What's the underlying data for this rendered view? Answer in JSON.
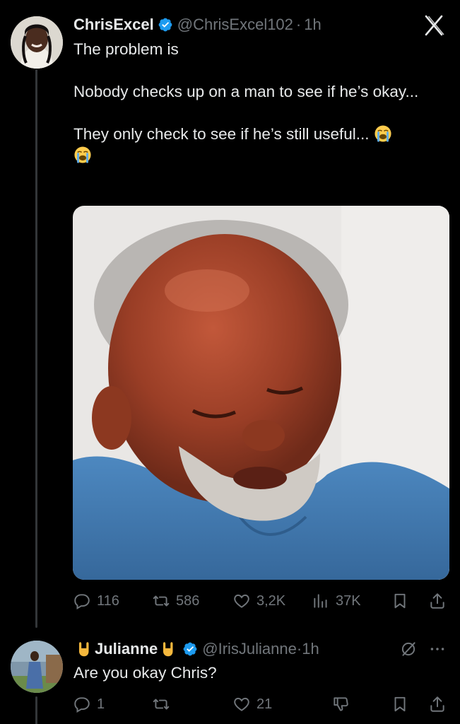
{
  "tweet": {
    "author_name": "ChrisExcel",
    "handle": "@ChrisExcel102",
    "separator": "·",
    "time": "1h",
    "paragraphs": [
      "The problem is",
      "Nobody checks up on a man to see if he’s okay...",
      "They only check to see if he’s still useful..."
    ],
    "emojis": [
      "loudly-crying-face",
      "loudly-crying-face"
    ],
    "media_alt": "",
    "stats": {
      "replies": "116",
      "reposts": "586",
      "likes": "3,2K",
      "views": "37K"
    }
  },
  "reply": {
    "author_name": "Julianne",
    "name_emoji": "sign-of-the-horns-hand",
    "handle": "@IrisJulianne",
    "separator": "·",
    "time": "1h",
    "text": "Are you okay Chris?",
    "stats": {
      "replies": "1",
      "likes": "21"
    }
  },
  "colors": {
    "background": "#000000",
    "text": "#e7e9ea",
    "muted": "#71767b",
    "verified": "#1d9bf0",
    "thread_line": "#333639"
  }
}
